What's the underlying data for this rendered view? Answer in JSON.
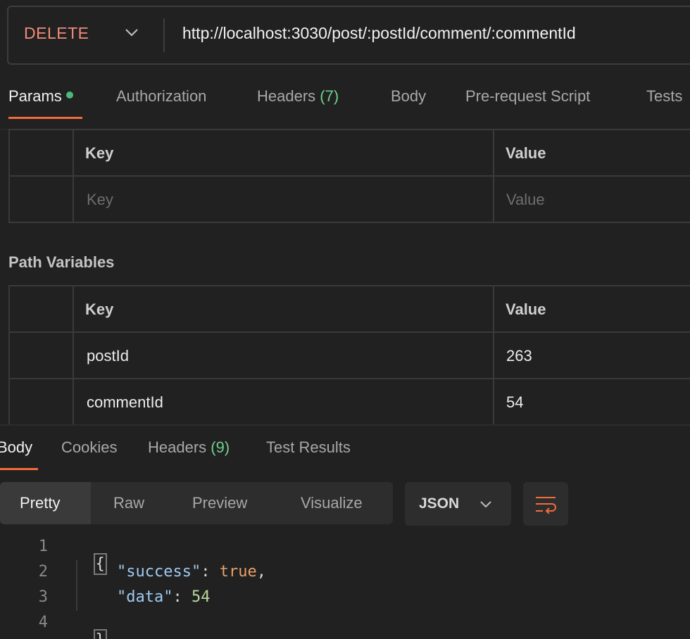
{
  "request": {
    "method": "DELETE",
    "url": "http://localhost:3030/post/:postId/comment/:commentId"
  },
  "request_tabs": {
    "params": "Params",
    "authorization": "Authorization",
    "headers": "Headers",
    "headers_count": "(7)",
    "body": "Body",
    "prerequest": "Pre-request Script",
    "tests": "Tests"
  },
  "query_params": {
    "key_header": "Key",
    "value_header": "Value",
    "key_placeholder": "Key",
    "value_placeholder": "Value"
  },
  "path_variables": {
    "title": "Path Variables",
    "key_header": "Key",
    "value_header": "Value",
    "rows": [
      {
        "key": "postId",
        "value": "263"
      },
      {
        "key": "commentId",
        "value": "54"
      }
    ]
  },
  "response_tabs": {
    "body": "Body",
    "cookies": "Cookies",
    "headers": "Headers",
    "headers_count": "(9)",
    "test_results": "Test Results"
  },
  "view_modes": {
    "pretty": "Pretty",
    "raw": "Raw",
    "preview": "Preview",
    "visualize": "Visualize",
    "format": "JSON"
  },
  "response_body": {
    "line_numbers": [
      "1",
      "2",
      "3",
      "4"
    ],
    "open_brace": "{",
    "close_brace": "}",
    "success_key": "\"success\"",
    "success_value": "true",
    "data_key": "\"data\"",
    "data_value": "54"
  },
  "icons": {
    "method_dropdown": "chevron-down-icon",
    "format_dropdown": "chevron-down-icon",
    "wrap": "wrap-lines-icon",
    "params_indicator": "status-dot-icon"
  },
  "colors": {
    "accent": "#f26b3a",
    "method": "#f08c7a",
    "count_green": "#6fcf8e",
    "json_key": "#9ecbf0",
    "json_bool": "#e8a06a",
    "json_number": "#b8d89a"
  }
}
